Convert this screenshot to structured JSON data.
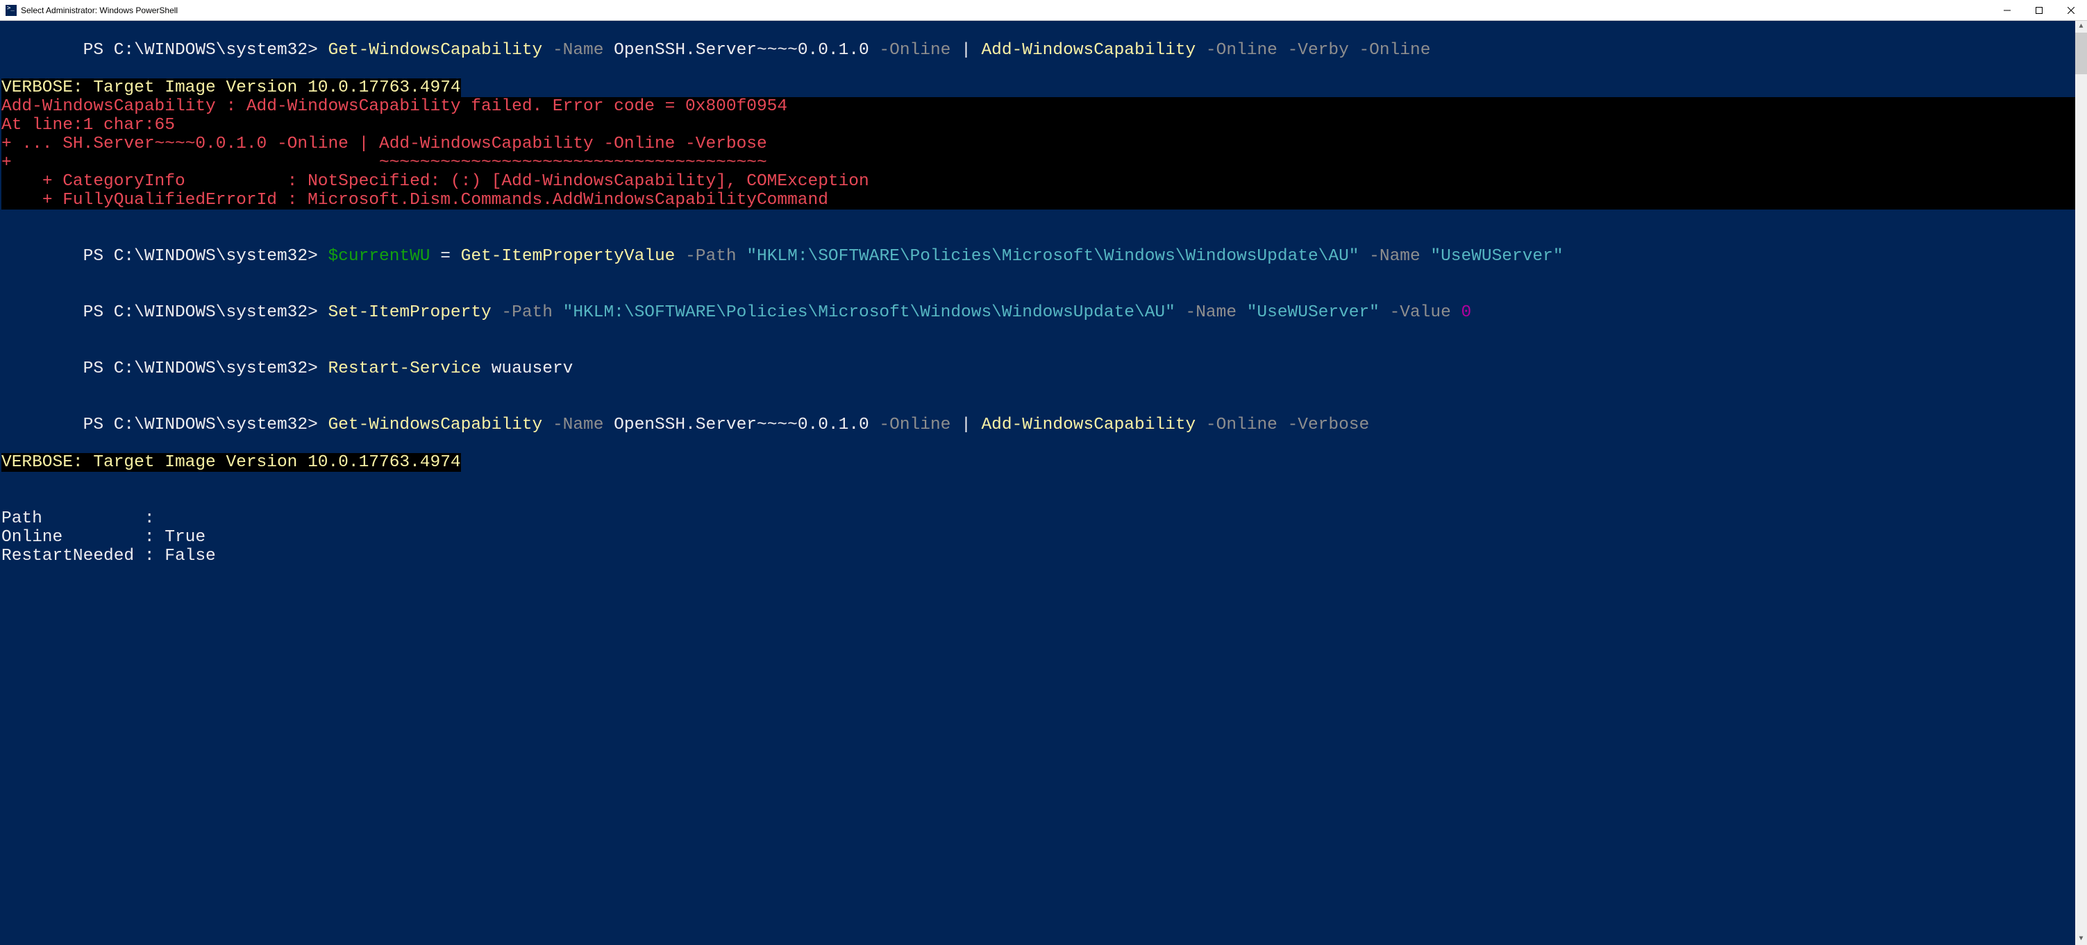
{
  "titlebar": {
    "title": "Select Administrator: Windows PowerShell"
  },
  "prompt": "PS C:\\WINDOWS\\system32> ",
  "cmd1": {
    "cmdlet1": "Get-WindowsCapability",
    "p_name": " -Name ",
    "name_val": "OpenSSH.Server~~~~0.0.1.0",
    "p_online1": " -Online ",
    "pipe": "| ",
    "cmdlet2": "Add-WindowsCapability",
    "p_online2": " -Online ",
    "p_verb_a": "-Verb",
    "p_verb_b": "y",
    "p_online3": " -Online"
  },
  "verbose1": "VERBOSE: Target Image Version 10.0.17763.4974",
  "error": {
    "l1": "Add-WindowsCapability : Add-WindowsCapability failed. Error code = 0x800f0954",
    "l2": "At line:1 char:65",
    "l3": "+ ... SH.Server~~~~0.0.1.0 -Online | Add-WindowsCapability -Online -Verbose",
    "l4": "+                                    ~~~~~~~~~~~~~~~~~~~~~~~~~~~~~~~~~~~~~~",
    "l5": "    + CategoryInfo          : NotSpecified: (:) [Add-WindowsCapability], COMException",
    "l6": "    + FullyQualifiedErrorId : Microsoft.Dism.Commands.AddWindowsCapabilityCommand"
  },
  "cmd2": {
    "var": "$currentWU",
    "eq": " = ",
    "cmdlet": "Get-ItemPropertyValue",
    "p_path": " -Path ",
    "path_val_a": "\"HKLM:\\SOFTWARE\\Policies\\Microsoft\\Windows\\WindowsUpdate\\A",
    "path_val_b": "U\"",
    "p_name": " -Name ",
    "name_val": "\"UseWUServer\""
  },
  "cmd3": {
    "cmdlet": "Set-ItemProperty",
    "p_path": " -Path ",
    "path_val": "\"HKLM:\\SOFTWARE\\Policies\\Microsoft\\Windows\\WindowsUpdate\\AU\"",
    "p_name": " -Name ",
    "name_val_a": "\"UseWUSer",
    "name_val_b": "ver\"",
    "p_value": " -Value ",
    "value_val": "0"
  },
  "cmd4": {
    "cmdlet": "Restart-Service",
    "arg": " wuauserv"
  },
  "cmd5": {
    "cmdlet1": "Get-WindowsCapability",
    "p_name": " -Name ",
    "name_val": "OpenSSH.Server~~~~0.0.1.0",
    "p_online1": " -Online ",
    "pipe": "| ",
    "cmdlet2": "Add-WindowsCapability",
    "p_online2": " -Online ",
    "p_verb_a": "-Verb",
    "p_verb_b": "ose"
  },
  "verbose2": "VERBOSE: Target Image Version 10.0.17763.4974",
  "output": {
    "l1": "Path          :",
    "l2": "Online        : True",
    "l3": "RestartNeeded : False"
  }
}
